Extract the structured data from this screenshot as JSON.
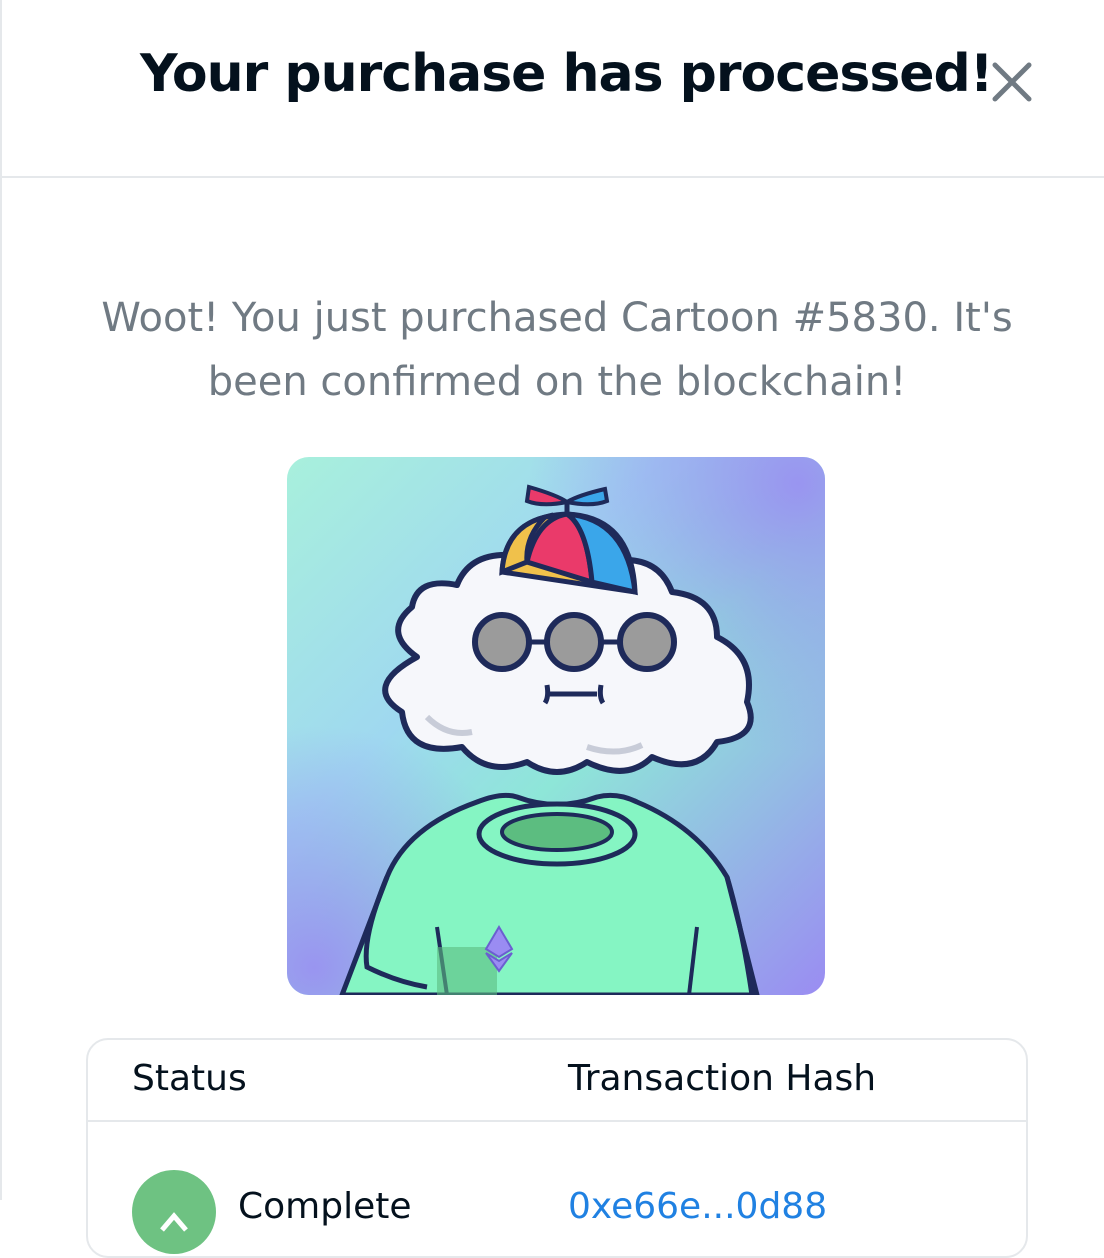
{
  "modal": {
    "title": "Your purchase has processed!",
    "close_icon": "close-icon"
  },
  "message": {
    "line1": "Woot! You just purchased Cartoon #5830. It's",
    "line2": "been confirmed on the blockchain!"
  },
  "nft": {
    "name": "Cartoon #5830",
    "background_colors": [
      "#a8f0dc",
      "#8ee6d8",
      "#9a8cf2"
    ]
  },
  "transaction": {
    "columns": [
      "Status",
      "Transaction Hash"
    ],
    "rows": [
      {
        "status": "Complete",
        "hash": "0xe66e...0d88"
      }
    ]
  },
  "colors": {
    "title": "#04111d",
    "message": "#707a83",
    "link": "#2081e2",
    "status_complete": "#6ec282",
    "border": "#e5e8eb"
  }
}
